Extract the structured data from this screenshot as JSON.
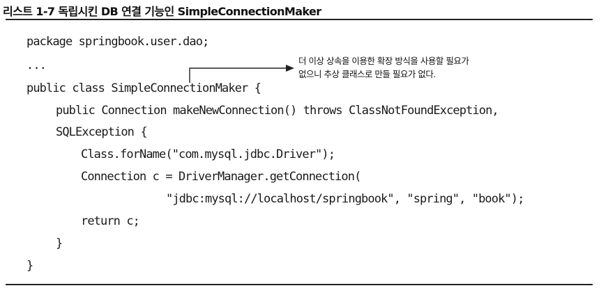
{
  "caption": "리스트 1-7 독립시킨 DB 연결 기능인 SimpleConnectionMaker",
  "code": [
    "package springbook.user.dao;",
    "...",
    "public class SimpleConnectionMaker {",
    "public Connection makeNewConnection() throws ClassNotFoundException,",
    "SQLException {",
    "Class.forName(\"com.mysql.jdbc.Driver\");",
    "Connection c = DriverManager.getConnection(",
    "\"jdbc:mysql://localhost/springbook\", \"spring\", \"book\");",
    "return c;",
    "}",
    "}"
  ],
  "annotation": {
    "line1": "더 이상 상속을 이용한 확장 방식을 사용할 필요가",
    "line2": "없으니 추상 클래스로 만들 필요가 없다."
  }
}
